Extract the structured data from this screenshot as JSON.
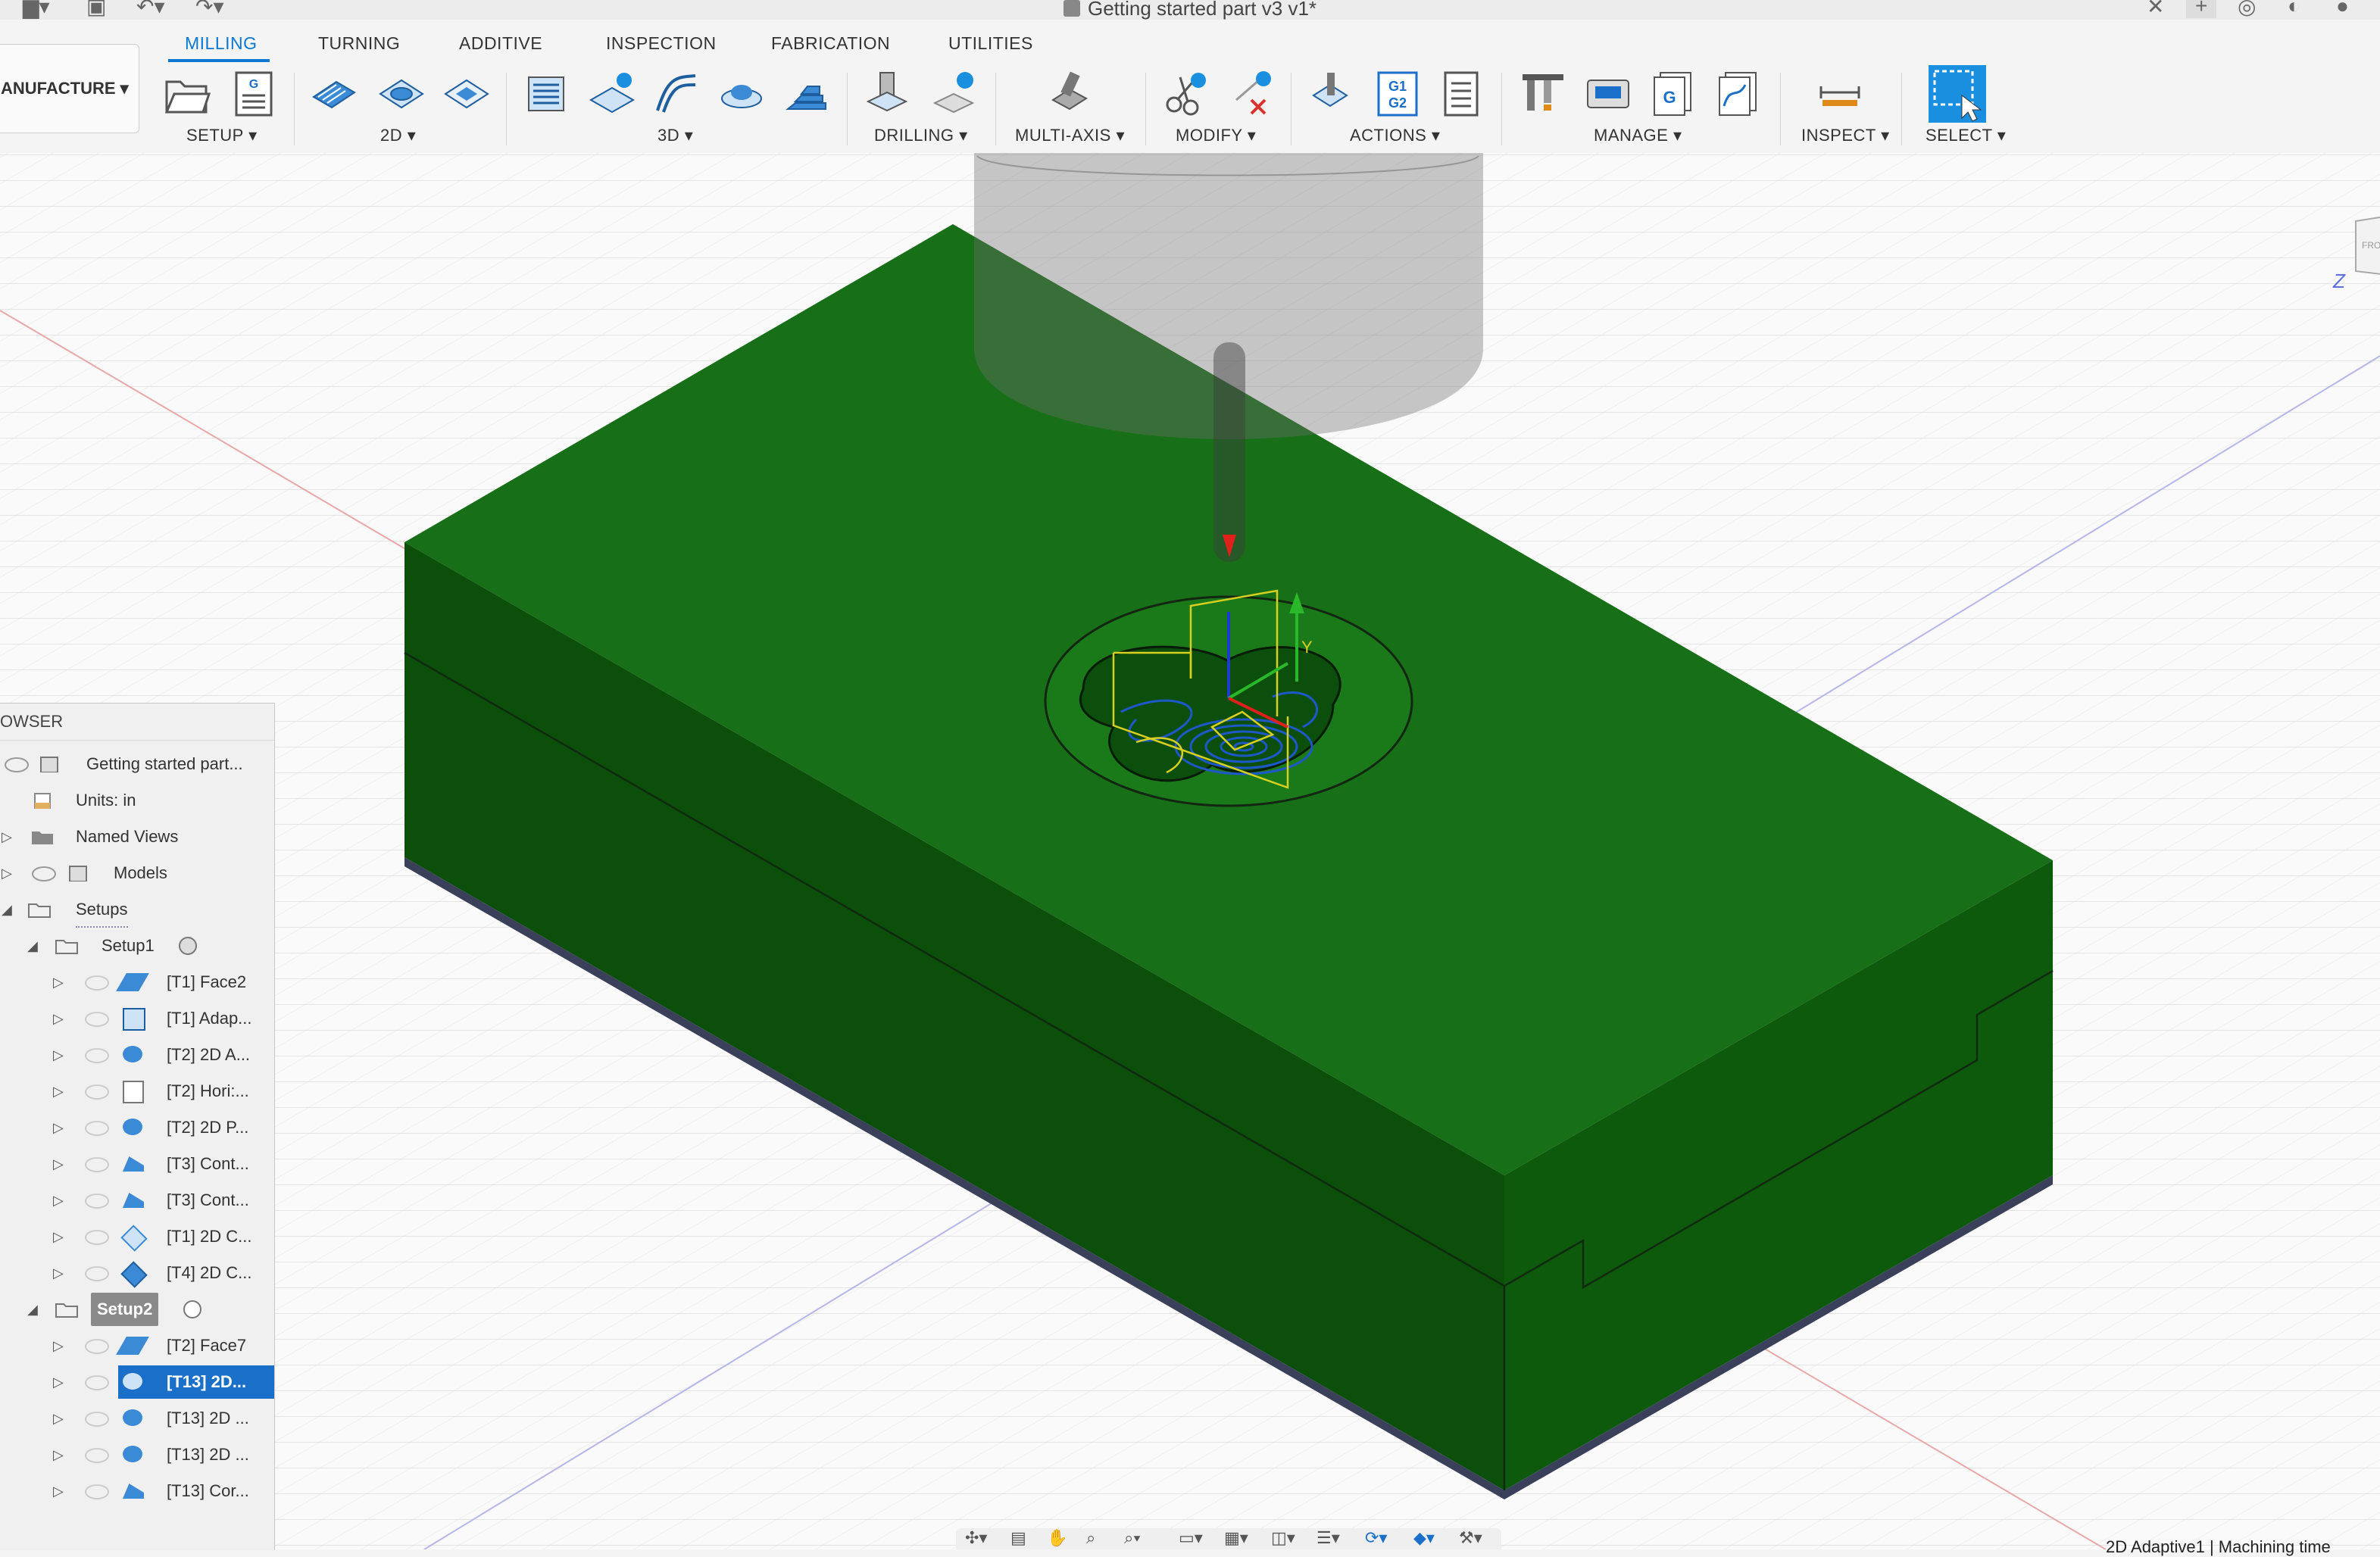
{
  "window": {
    "title": "Getting started part v3 v1*"
  },
  "tabs": [
    {
      "label": "MILLING",
      "active": true
    },
    {
      "label": "TURNING"
    },
    {
      "label": "ADDITIVE"
    },
    {
      "label": "INSPECTION"
    },
    {
      "label": "FABRICATION"
    },
    {
      "label": "UTILITIES"
    }
  ],
  "workspace": {
    "label": "ANUFACTURE ▾"
  },
  "toolbar": {
    "groups": [
      {
        "label": "SETUP ▾"
      },
      {
        "label": "2D ▾"
      },
      {
        "label": "3D ▾"
      },
      {
        "label": "DRILLING ▾"
      },
      {
        "label": "MULTI-AXIS ▾"
      },
      {
        "label": "MODIFY ▾"
      },
      {
        "label": "ACTIONS ▾"
      },
      {
        "label": "MANAGE ▾"
      },
      {
        "label": "INSPECT ▾"
      },
      {
        "label": "SELECT ▾"
      }
    ],
    "gcode_glyph": "G1\nG2",
    "g_glyph": "G"
  },
  "browser": {
    "header": "OWSER",
    "items": [
      {
        "label": "Getting started part..."
      },
      {
        "label": "Units: in"
      },
      {
        "label": "Named Views"
      },
      {
        "label": "Models"
      },
      {
        "label": "Setups"
      },
      {
        "label": "Setup1"
      },
      {
        "label": "[T1] Face2"
      },
      {
        "label": "[T1] Adap..."
      },
      {
        "label": "[T2] 2D A..."
      },
      {
        "label": "[T2] Hori:..."
      },
      {
        "label": "[T2] 2D P..."
      },
      {
        "label": "[T3] Cont..."
      },
      {
        "label": "[T3] Cont..."
      },
      {
        "label": "[T1] 2D C..."
      },
      {
        "label": "[T4] 2D C..."
      },
      {
        "label": "Setup2"
      },
      {
        "label": "[T2] Face7"
      },
      {
        "label": "[T13] 2D..."
      },
      {
        "label": "[T13] 2D ..."
      },
      {
        "label": "[T13] 2D ..."
      },
      {
        "label": "[T13] Cor..."
      }
    ]
  },
  "status": {
    "text": "2D Adaptive1 | Machining time"
  },
  "viewport": {
    "axis_y": "Y",
    "axis_z": "Z",
    "cube_text": "FRO"
  },
  "colors": {
    "accent": "#0a78d1",
    "stock_top": "#176f17",
    "stock_side": "#0b4f0b",
    "selection": "#1a6fc9"
  }
}
